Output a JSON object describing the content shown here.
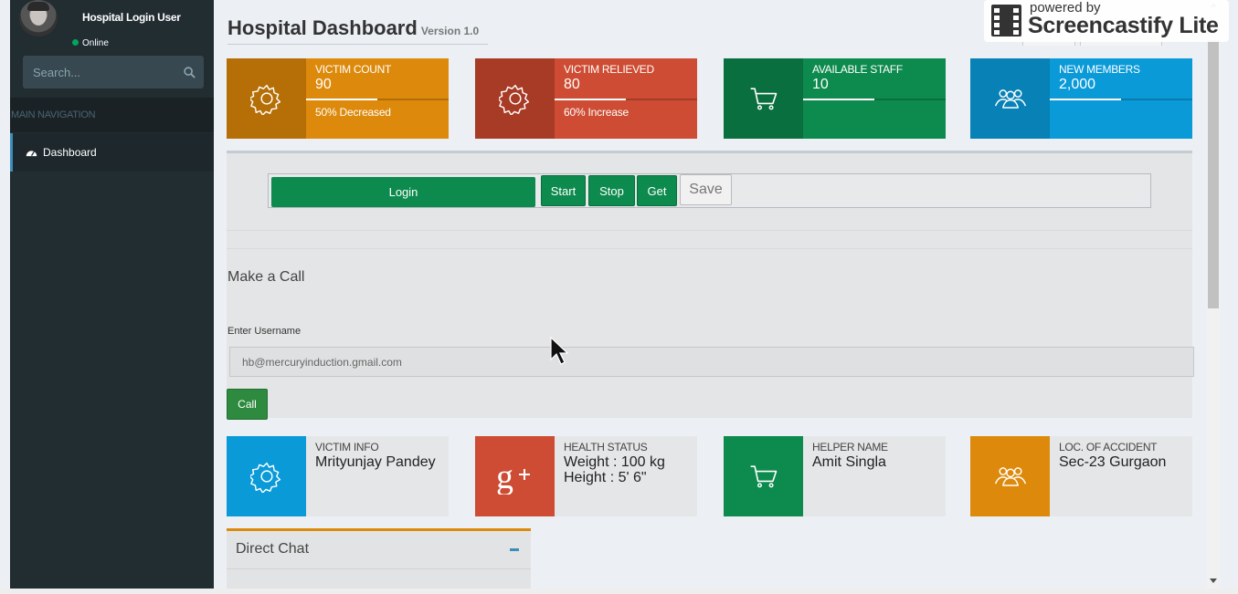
{
  "sidebar": {
    "user_name": "Hospital Login User",
    "status": "Online",
    "search_placeholder": "Search...",
    "section_header": "MAIN NAVIGATION",
    "nav_items": [
      {
        "label": "Dashboard",
        "icon": "dashboard-icon"
      }
    ]
  },
  "header": {
    "title": "Hospital Dashboard",
    "version": "Version 1.0"
  },
  "stats": [
    {
      "label": "VICTIM COUNT",
      "number": "90",
      "description": "50% Decreased",
      "progress": 0.5,
      "icon": "gear-icon",
      "color": "#dd8a0c"
    },
    {
      "label": "VICTIM RELIEVED",
      "number": "80",
      "description": "60% Increase",
      "progress": 0.5,
      "icon": "gear-icon",
      "color": "#cd4c33"
    },
    {
      "label": "AVAILABLE STAFF",
      "number": "10",
      "description": "",
      "progress": 0.5,
      "icon": "cart-icon",
      "color": "#0d8a4d"
    },
    {
      "label": "NEW MEMBERS",
      "number": "2,000",
      "description": "",
      "progress": 0.5,
      "icon": "users-icon",
      "color": "#0a9ad8"
    }
  ],
  "controls": {
    "login": "Login",
    "start": "Start",
    "stop": "Stop",
    "get": "Get",
    "save": "Save"
  },
  "call": {
    "title": "Make a Call",
    "username_label": "Enter Username",
    "username_value": "hb@mercuryinduction.gmail.com",
    "call_button": "Call"
  },
  "details": [
    {
      "label": "VICTIM INFO",
      "lines": [
        "Mrityunjay Pandey"
      ],
      "icon": "gear-icon",
      "color": "#0a9ad8"
    },
    {
      "label": "HEALTH STATUS",
      "lines": [
        "Weight : 100 kg",
        "Height : 5' 6\""
      ],
      "icon": "google-plus-icon",
      "color": "#cd4c33"
    },
    {
      "label": "HELPER NAME",
      "lines": [
        "Amit Singla"
      ],
      "icon": "cart-icon",
      "color": "#0d8a4d"
    },
    {
      "label": "LOC. OF ACCIDENT",
      "lines": [
        "Sec-23 Gurgaon"
      ],
      "icon": "users-icon",
      "color": "#dd8a0c"
    }
  ],
  "chat": {
    "title": "Direct Chat"
  },
  "watermark": {
    "small": "powered by",
    "big": "Screencastify Lite"
  }
}
